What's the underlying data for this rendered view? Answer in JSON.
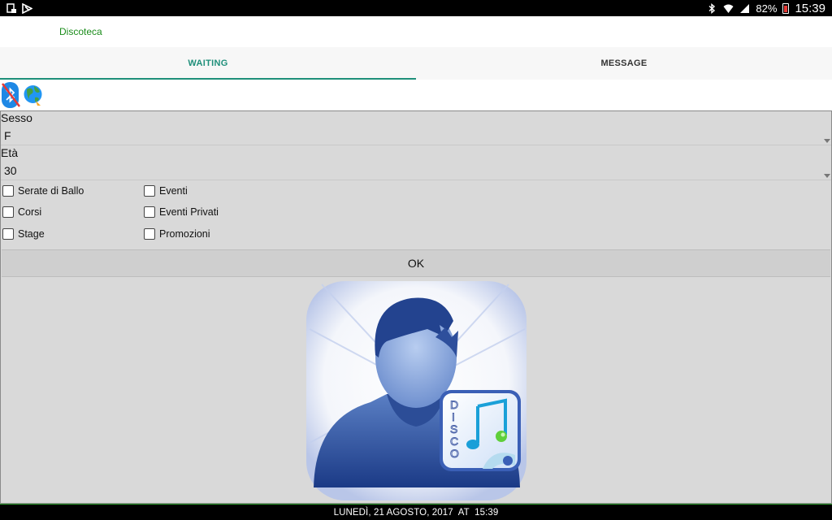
{
  "status_bar": {
    "battery_percent": "82%",
    "time": "15:39",
    "icons": [
      "screenshot-icon",
      "notification-flag-icon",
      "bluetooth-icon",
      "wifi-icon",
      "signal-icon",
      "battery-icon"
    ]
  },
  "app": {
    "title": "Discoteca"
  },
  "tabs": [
    {
      "label": "WAITING",
      "active": true
    },
    {
      "label": "MESSAGE",
      "active": false
    }
  ],
  "connection_icons": [
    "bluetooth-disabled-icon",
    "globe-icon"
  ],
  "form": {
    "sesso_label": "Sesso",
    "sesso_value": "F",
    "eta_label": "Età",
    "eta_value": "30",
    "checkboxes": [
      {
        "label": "Serate di Ballo",
        "checked": false
      },
      {
        "label": "Eventi",
        "checked": false
      },
      {
        "label": "Corsi",
        "checked": false
      },
      {
        "label": "Eventi Privati",
        "checked": false
      },
      {
        "label": "Stage",
        "checked": false
      },
      {
        "label": "Promozioni",
        "checked": false
      }
    ],
    "ok_label": "OK"
  },
  "logo": {
    "badge_text": "DISCO"
  },
  "footer": {
    "datetime": "LUNEDÌ, 21 AGOSTO, 2017  AT  15:39"
  },
  "colors": {
    "accent": "#1f8f7a",
    "app_title": "#1a8c1a",
    "panel_bg": "#d9d9d9"
  }
}
